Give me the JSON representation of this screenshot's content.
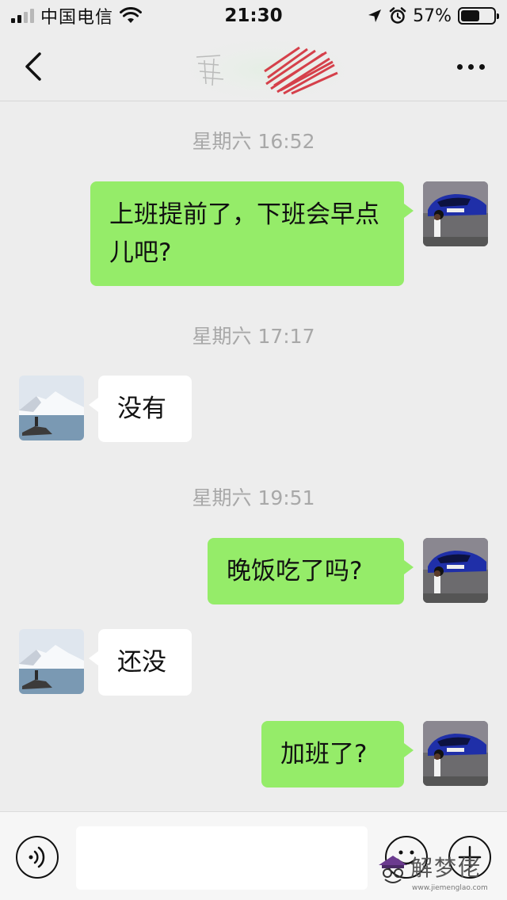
{
  "status_bar": {
    "carrier": "中国电信",
    "time": "21:30",
    "battery_percent": "57%",
    "battery_level": 0.57,
    "signal_bars": 2,
    "icons": [
      "signal-icon",
      "wifi-icon",
      "location-arrow-icon",
      "alarm-icon",
      "battery-icon"
    ]
  },
  "nav_bar": {
    "back_icon": "chevron-left-icon",
    "more_icon": "ellipsis-icon"
  },
  "messages": [
    {
      "type": "timestamp",
      "text": "星期六 16:52"
    },
    {
      "type": "message",
      "sender": "me",
      "text": "上班提前了，下班会早点儿吧?"
    },
    {
      "type": "timestamp",
      "text": "星期六 17:17"
    },
    {
      "type": "message",
      "sender": "them",
      "text": "没有"
    },
    {
      "type": "timestamp",
      "text": "星期六 19:51"
    },
    {
      "type": "message",
      "sender": "me",
      "text": "晚饭吃了吗?"
    },
    {
      "type": "message",
      "sender": "them",
      "text": "还没"
    },
    {
      "type": "message",
      "sender": "me",
      "text": "加班了?"
    }
  ],
  "input_bar": {
    "voice_icon": "voice-icon",
    "emoji_icon": "emoji-icon",
    "add_icon": "plus-icon",
    "input_value": ""
  },
  "watermark": {
    "text": "解梦佬",
    "url": "www.jiemenglao.com"
  },
  "colors": {
    "background": "#ededed",
    "my_bubble": "#95ec69",
    "their_bubble": "#ffffff",
    "timestamp": "#a8a8a8"
  }
}
